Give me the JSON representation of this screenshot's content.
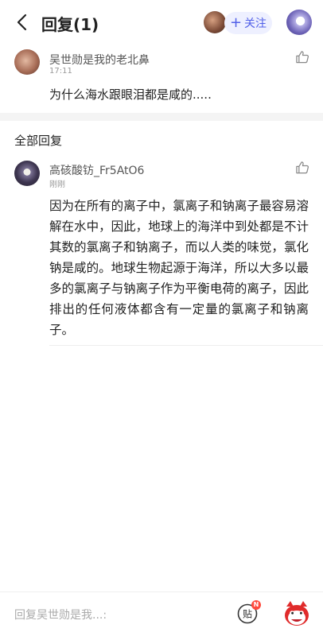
{
  "header": {
    "title": "回复(1)",
    "follow_label": "关注"
  },
  "post": {
    "username": "吴世勋是我的老北鼻",
    "time": "17:11",
    "text": "为什么海水跟眼泪都是咸的....."
  },
  "section": {
    "title": "全部回复"
  },
  "reply": {
    "username": "高硋酸钫_Fr5AtO6",
    "time": "刚刚",
    "text": "因为在所有的离子中，氯离子和钠离子最容易溶解在水中，因此，地球上的海洋中到处都是不计其数的氯离子和钠离子，而以人类的味觉，氯化钠是咸的。地球生物起源于海洋，所以大多以最多的氯离子与钠离子作为平衡电荷的离子，因此排出的任何液体都含有一定量的氯离子和钠离子。"
  },
  "bottom": {
    "placeholder": "回复吴世勋是我...:",
    "sticker_label": "贴",
    "sticker_badge": "N"
  },
  "colors": {
    "accent": "#5160e8",
    "badge": "#ff4a3d"
  },
  "icons": [
    "back-icon",
    "thumbs-up-icon",
    "sticker-icon",
    "emoji-icon"
  ]
}
